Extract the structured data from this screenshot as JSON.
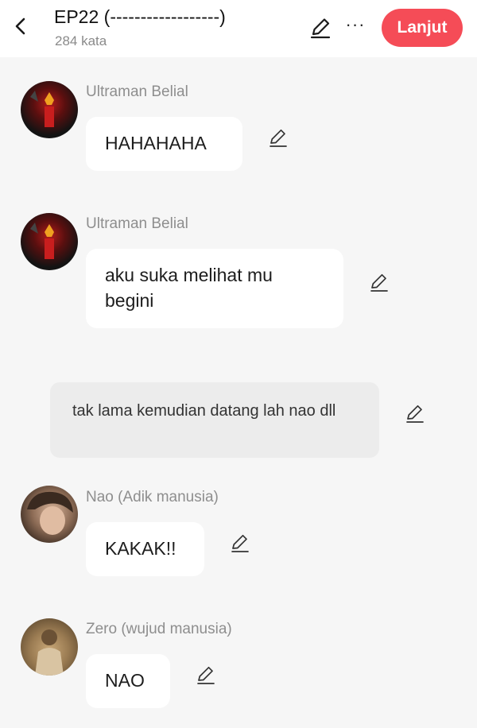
{
  "header": {
    "back_icon": "chevron-left-icon",
    "title": "EP22 (------------------)",
    "word_count": "284 kata",
    "edit_icon": "pencil-icon",
    "more_icon": "more-dots-icon",
    "more_label": "···",
    "next_label": "Lanjut",
    "accent_color": "#f54c57"
  },
  "messages": [
    {
      "speaker": "Ultraman Belial",
      "text": "HAHAHAHA"
    },
    {
      "speaker": "Ultraman Belial",
      "text": "aku suka melihat mu begini"
    },
    {
      "narration": "tak lama kemudian datang lah nao dll"
    },
    {
      "speaker": "Nao (Adik manusia)",
      "text": "KAKAK!!"
    },
    {
      "speaker": "Zero (wujud manusia)",
      "text": "NAO"
    }
  ]
}
